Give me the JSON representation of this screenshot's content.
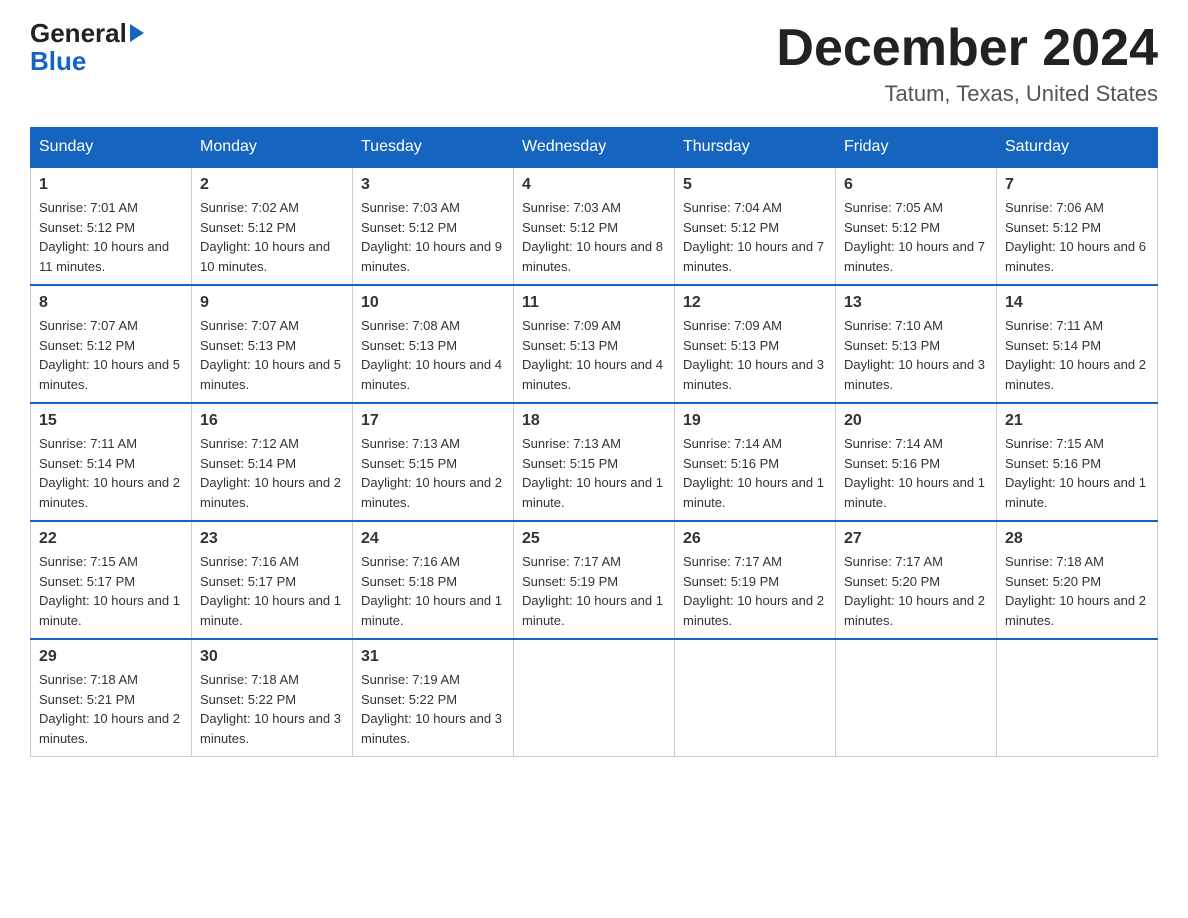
{
  "header": {
    "logo_line1": "General",
    "logo_line2": "Blue",
    "month_title": "December 2024",
    "location": "Tatum, Texas, United States"
  },
  "days_of_week": [
    "Sunday",
    "Monday",
    "Tuesday",
    "Wednesday",
    "Thursday",
    "Friday",
    "Saturday"
  ],
  "weeks": [
    [
      {
        "num": "1",
        "sunrise": "7:01 AM",
        "sunset": "5:12 PM",
        "daylight": "10 hours and 11 minutes."
      },
      {
        "num": "2",
        "sunrise": "7:02 AM",
        "sunset": "5:12 PM",
        "daylight": "10 hours and 10 minutes."
      },
      {
        "num": "3",
        "sunrise": "7:03 AM",
        "sunset": "5:12 PM",
        "daylight": "10 hours and 9 minutes."
      },
      {
        "num": "4",
        "sunrise": "7:03 AM",
        "sunset": "5:12 PM",
        "daylight": "10 hours and 8 minutes."
      },
      {
        "num": "5",
        "sunrise": "7:04 AM",
        "sunset": "5:12 PM",
        "daylight": "10 hours and 7 minutes."
      },
      {
        "num": "6",
        "sunrise": "7:05 AM",
        "sunset": "5:12 PM",
        "daylight": "10 hours and 7 minutes."
      },
      {
        "num": "7",
        "sunrise": "7:06 AM",
        "sunset": "5:12 PM",
        "daylight": "10 hours and 6 minutes."
      }
    ],
    [
      {
        "num": "8",
        "sunrise": "7:07 AM",
        "sunset": "5:12 PM",
        "daylight": "10 hours and 5 minutes."
      },
      {
        "num": "9",
        "sunrise": "7:07 AM",
        "sunset": "5:13 PM",
        "daylight": "10 hours and 5 minutes."
      },
      {
        "num": "10",
        "sunrise": "7:08 AM",
        "sunset": "5:13 PM",
        "daylight": "10 hours and 4 minutes."
      },
      {
        "num": "11",
        "sunrise": "7:09 AM",
        "sunset": "5:13 PM",
        "daylight": "10 hours and 4 minutes."
      },
      {
        "num": "12",
        "sunrise": "7:09 AM",
        "sunset": "5:13 PM",
        "daylight": "10 hours and 3 minutes."
      },
      {
        "num": "13",
        "sunrise": "7:10 AM",
        "sunset": "5:13 PM",
        "daylight": "10 hours and 3 minutes."
      },
      {
        "num": "14",
        "sunrise": "7:11 AM",
        "sunset": "5:14 PM",
        "daylight": "10 hours and 2 minutes."
      }
    ],
    [
      {
        "num": "15",
        "sunrise": "7:11 AM",
        "sunset": "5:14 PM",
        "daylight": "10 hours and 2 minutes."
      },
      {
        "num": "16",
        "sunrise": "7:12 AM",
        "sunset": "5:14 PM",
        "daylight": "10 hours and 2 minutes."
      },
      {
        "num": "17",
        "sunrise": "7:13 AM",
        "sunset": "5:15 PM",
        "daylight": "10 hours and 2 minutes."
      },
      {
        "num": "18",
        "sunrise": "7:13 AM",
        "sunset": "5:15 PM",
        "daylight": "10 hours and 1 minute."
      },
      {
        "num": "19",
        "sunrise": "7:14 AM",
        "sunset": "5:16 PM",
        "daylight": "10 hours and 1 minute."
      },
      {
        "num": "20",
        "sunrise": "7:14 AM",
        "sunset": "5:16 PM",
        "daylight": "10 hours and 1 minute."
      },
      {
        "num": "21",
        "sunrise": "7:15 AM",
        "sunset": "5:16 PM",
        "daylight": "10 hours and 1 minute."
      }
    ],
    [
      {
        "num": "22",
        "sunrise": "7:15 AM",
        "sunset": "5:17 PM",
        "daylight": "10 hours and 1 minute."
      },
      {
        "num": "23",
        "sunrise": "7:16 AM",
        "sunset": "5:17 PM",
        "daylight": "10 hours and 1 minute."
      },
      {
        "num": "24",
        "sunrise": "7:16 AM",
        "sunset": "5:18 PM",
        "daylight": "10 hours and 1 minute."
      },
      {
        "num": "25",
        "sunrise": "7:17 AM",
        "sunset": "5:19 PM",
        "daylight": "10 hours and 1 minute."
      },
      {
        "num": "26",
        "sunrise": "7:17 AM",
        "sunset": "5:19 PM",
        "daylight": "10 hours and 2 minutes."
      },
      {
        "num": "27",
        "sunrise": "7:17 AM",
        "sunset": "5:20 PM",
        "daylight": "10 hours and 2 minutes."
      },
      {
        "num": "28",
        "sunrise": "7:18 AM",
        "sunset": "5:20 PM",
        "daylight": "10 hours and 2 minutes."
      }
    ],
    [
      {
        "num": "29",
        "sunrise": "7:18 AM",
        "sunset": "5:21 PM",
        "daylight": "10 hours and 2 minutes."
      },
      {
        "num": "30",
        "sunrise": "7:18 AM",
        "sunset": "5:22 PM",
        "daylight": "10 hours and 3 minutes."
      },
      {
        "num": "31",
        "sunrise": "7:19 AM",
        "sunset": "5:22 PM",
        "daylight": "10 hours and 3 minutes."
      },
      null,
      null,
      null,
      null
    ]
  ],
  "labels": {
    "sunrise": "Sunrise:",
    "sunset": "Sunset:",
    "daylight": "Daylight:"
  }
}
